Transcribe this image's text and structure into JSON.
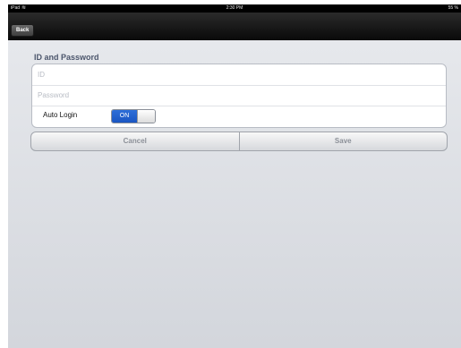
{
  "status_bar": {
    "device": "iPad",
    "wifi_icon": "wifi-icon",
    "time": "2:30 PM",
    "battery": "55 %"
  },
  "nav": {
    "back_label": "Back"
  },
  "form": {
    "section_title": "ID and Password",
    "id_value": "",
    "id_placeholder": "ID",
    "password_value": "",
    "password_placeholder": "Password",
    "auto_login_label": "Auto Login",
    "auto_login_state": "ON"
  },
  "actions": {
    "cancel_label": "Cancel",
    "save_label": "Save"
  },
  "colors": {
    "toggle_on": "#1a55c2",
    "background": "#d9dce3"
  }
}
